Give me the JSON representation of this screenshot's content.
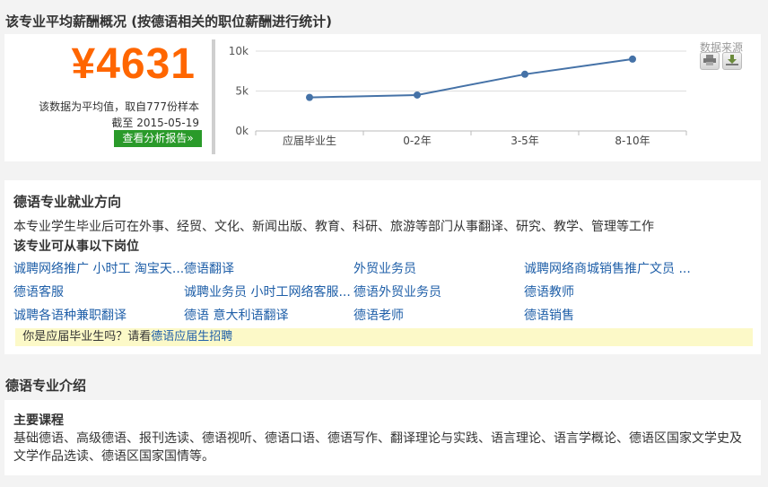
{
  "salary": {
    "section_title": "该专业平均薪酬概况 (按德语相关的职位薪酬进行统计)",
    "average": "¥4631",
    "note_prefix": "该数据为平均值，取自",
    "sample_count": "777",
    "note_suffix": "份样本",
    "as_of_label": "截至",
    "as_of_date": "2015-05-19",
    "report_button": "查看分析报告»",
    "source_label": "数据来源"
  },
  "chart_data": {
    "type": "line",
    "categories": [
      "应届毕业生",
      "0-2年",
      "3-5年",
      "8-10年"
    ],
    "values": [
      4200,
      4500,
      7100,
      9000
    ],
    "yticks": [
      "0k",
      "5k",
      "10k"
    ],
    "ylim": [
      0,
      10000
    ],
    "grid": true,
    "colors": {
      "line": "#4572a7"
    }
  },
  "employment": {
    "title": "德语专业就业方向",
    "description": "本专业学生毕业后可在外事、经贸、文化、新闻出版、教育、科研、旅游等部门从事翻译、研究、教学、管理等工作",
    "positions_title": "该专业可从事以下岗位",
    "jobs": [
      [
        "诚聘网络推广 小时工 淘宝天...",
        "德语翻译",
        "外贸业务员",
        "诚聘网络商城销售推广文员 ..."
      ],
      [
        "德语客服",
        "诚聘业务员 小时工网络客服...",
        "德语外贸业务员",
        "德语教师"
      ],
      [
        "诚聘各语种兼职翻译",
        "德语 意大利语翻译",
        "德语老师",
        "德语销售"
      ]
    ],
    "hint_prefix": "你是应届毕业生吗？请看",
    "hint_link": "德语应届生招聘"
  },
  "intro": {
    "section_title": "德语专业介绍",
    "courses_title": "主要课程",
    "courses": "基础德语、高级德语、报刊选读、德语视听、德语口语、德语写作、翻译理论与实践、语言理论、语言学概论、德语区国家文学史及文学作品选读、德语区国家国情等。"
  }
}
